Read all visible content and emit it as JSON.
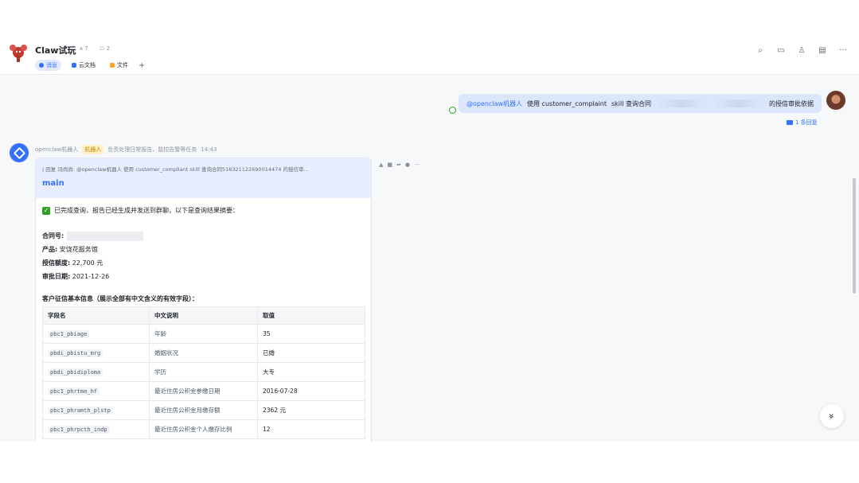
{
  "header": {
    "group_name": "Claw试玩",
    "members": "7",
    "bots": "2",
    "tabs": [
      {
        "label": "消息",
        "icon": "message-icon",
        "active": true
      },
      {
        "label": "云文档",
        "icon": "doc-icon",
        "active": false
      },
      {
        "label": "文件",
        "icon": "folder-icon",
        "active": false
      }
    ],
    "add_tab": "+",
    "actions": [
      "search-icon",
      "video-icon",
      "member-icon",
      "notes-icon",
      "more-icon"
    ]
  },
  "my_message": {
    "mention": "@openclaw机器人",
    "text_before": "使用 customer_complaint",
    "text_middle": "skill 查询合同",
    "text_after": "的授信审批依据",
    "replies": "1 条回复"
  },
  "bot_message": {
    "name": "openclaw机器人",
    "badge": "机器人",
    "description": "负责处理日常报告、监控告警等任务",
    "time": "14:43",
    "quote": "| 回复 冯尚尚: @openclaw机器人 使用 customer_compliant skill 查询合同516321122690014474 的授信审...",
    "card_title": "main",
    "done_text": "已完成查询，报告已经生成并发送到群聊，以下是查询结果摘要：",
    "contract_label": "合同号:",
    "product_label": "产品:",
    "product_value": "安饶花服务馆",
    "credit_label": "授信额度:",
    "credit_value": "22,700 元",
    "date_label": "审批日期:",
    "date_value": "2021-12-26",
    "section_title": "客户征信基本信息（展示全部有中文含义的有效字段）：",
    "table_headers": [
      "字段名",
      "中文说明",
      "取值"
    ],
    "table_rows": [
      {
        "field": "pbc1_pbiage",
        "desc": "年龄",
        "value": "35"
      },
      {
        "field": "pbdi_pbistu_mrg",
        "desc": "婚姻状况",
        "value": "已婚"
      },
      {
        "field": "pbdi_pbidiploma",
        "desc": "学历",
        "value": "大专"
      },
      {
        "field": "pbc1_phrtme_hf",
        "desc": "最近住房公积金参缴日期",
        "value": "2016-07-28"
      },
      {
        "field": "pbc1_phramth_plstp",
        "desc": "最近住房公积金月缴存额",
        "value": "2362 元"
      },
      {
        "field": "pbc1_phrpcth_indp",
        "desc": "最近住房公积金个人缴存比例",
        "value": "12"
      }
    ]
  },
  "scroll_button": "»"
}
